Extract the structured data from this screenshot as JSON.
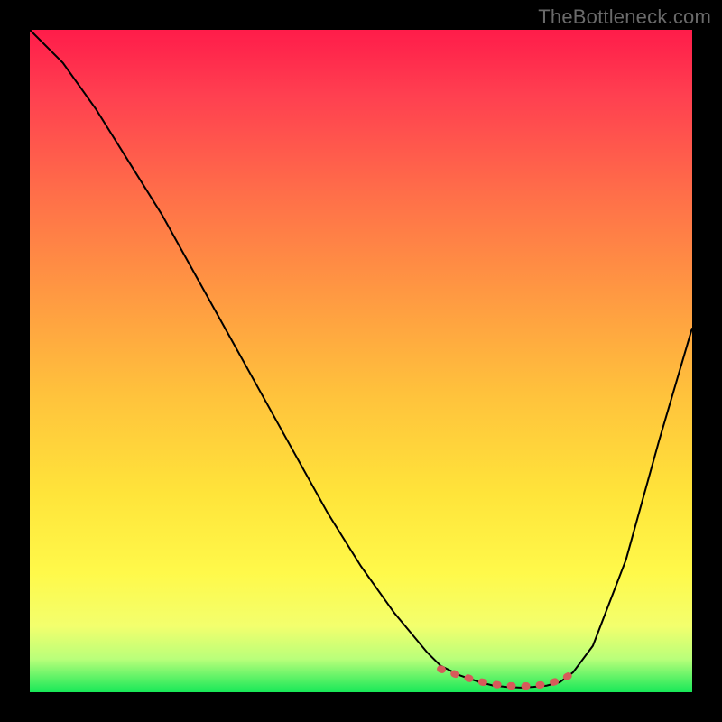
{
  "watermark": "TheBottleneck.com",
  "chart_data": {
    "type": "line",
    "title": "",
    "xlabel": "",
    "ylabel": "",
    "xlim": [
      0,
      100
    ],
    "ylim": [
      0,
      100
    ],
    "series": [
      {
        "name": "curve",
        "x": [
          0,
          5,
          10,
          15,
          20,
          25,
          30,
          35,
          40,
          45,
          50,
          55,
          60,
          62,
          65,
          68,
          70,
          72,
          74,
          76,
          78,
          80,
          82,
          85,
          90,
          95,
          100
        ],
        "y": [
          100,
          95,
          88,
          80,
          72,
          63,
          54,
          45,
          36,
          27,
          19,
          12,
          6,
          4,
          2.5,
          1.5,
          1,
          0.8,
          0.7,
          0.8,
          1,
          1.5,
          3,
          7,
          20,
          38,
          55
        ]
      },
      {
        "name": "highlight-band",
        "x": [
          62,
          64,
          66,
          68,
          70,
          72,
          74,
          76,
          78,
          80,
          82
        ],
        "y": [
          3.5,
          2.8,
          2.2,
          1.6,
          1.2,
          1.0,
          0.9,
          1.0,
          1.2,
          1.8,
          2.8
        ]
      }
    ],
    "colors": {
      "curve": "#000000",
      "highlight": "#d65a5a",
      "background_gradient": [
        "#ff1c4a",
        "#ff6f49",
        "#ffc23c",
        "#fff94a",
        "#17e858"
      ]
    }
  }
}
